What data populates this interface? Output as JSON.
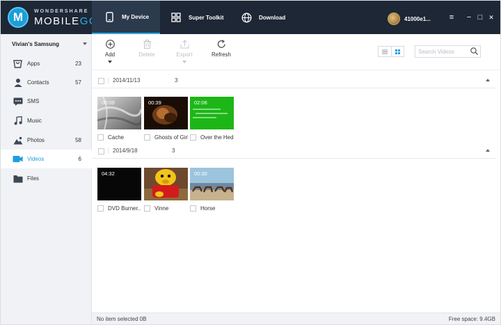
{
  "app": {
    "brand_line1": "WONDERSHARE",
    "brand_line2_a": "MOBILE",
    "brand_line2_b": "GO",
    "brand_mark": "M",
    "accent_color": "#2ea7e8",
    "titlebar_color": "#1d2735"
  },
  "tabs": [
    {
      "label": "My Device",
      "icon": "phone-icon",
      "active": true
    },
    {
      "label": "Super Toolkit",
      "icon": "grid-icon",
      "active": false
    },
    {
      "label": "Download",
      "icon": "globe-icon",
      "active": false
    }
  ],
  "device": {
    "name": "41000e1...",
    "selector_label": "Vivian's Samsung"
  },
  "window_controls": {
    "menu": "≡",
    "minimize": "−",
    "maximize": "□",
    "close": "✕"
  },
  "sidebar": {
    "items": [
      {
        "label": "Apps",
        "count": "23",
        "icon": "apps-icon"
      },
      {
        "label": "Contacts",
        "count": "57",
        "icon": "contacts-icon"
      },
      {
        "label": "SMS",
        "count": "",
        "icon": "sms-icon"
      },
      {
        "label": "Music",
        "count": "",
        "icon": "music-icon"
      },
      {
        "label": "Photos",
        "count": "58",
        "icon": "photos-icon"
      },
      {
        "label": "Videos",
        "count": "6",
        "icon": "videos-icon",
        "active": true
      },
      {
        "label": "Files",
        "count": "",
        "icon": "files-icon"
      }
    ]
  },
  "toolbar": {
    "add_label": "Add",
    "delete_label": "Delete",
    "export_label": "Export",
    "refresh_label": "Refresh",
    "search_placeholder": "Search Videos"
  },
  "groups": [
    {
      "date": "2014/11/13",
      "count": "3",
      "videos": [
        {
          "title": "Cache",
          "duration": "00:09"
        },
        {
          "title": "Ghosts of Girl...",
          "duration": "00:39"
        },
        {
          "title": "Over the Hed...",
          "duration": "02:06"
        }
      ]
    },
    {
      "date": "2014/9/18",
      "count": "3",
      "videos": [
        {
          "title": "DVD Burner...",
          "duration": "04:32"
        },
        {
          "title": "Vinne",
          "duration": ""
        },
        {
          "title": "Horse",
          "duration": "00:30"
        }
      ]
    }
  ],
  "status": {
    "selection": "No item selected 0B",
    "free_space": "Free space: 9.4GB"
  }
}
